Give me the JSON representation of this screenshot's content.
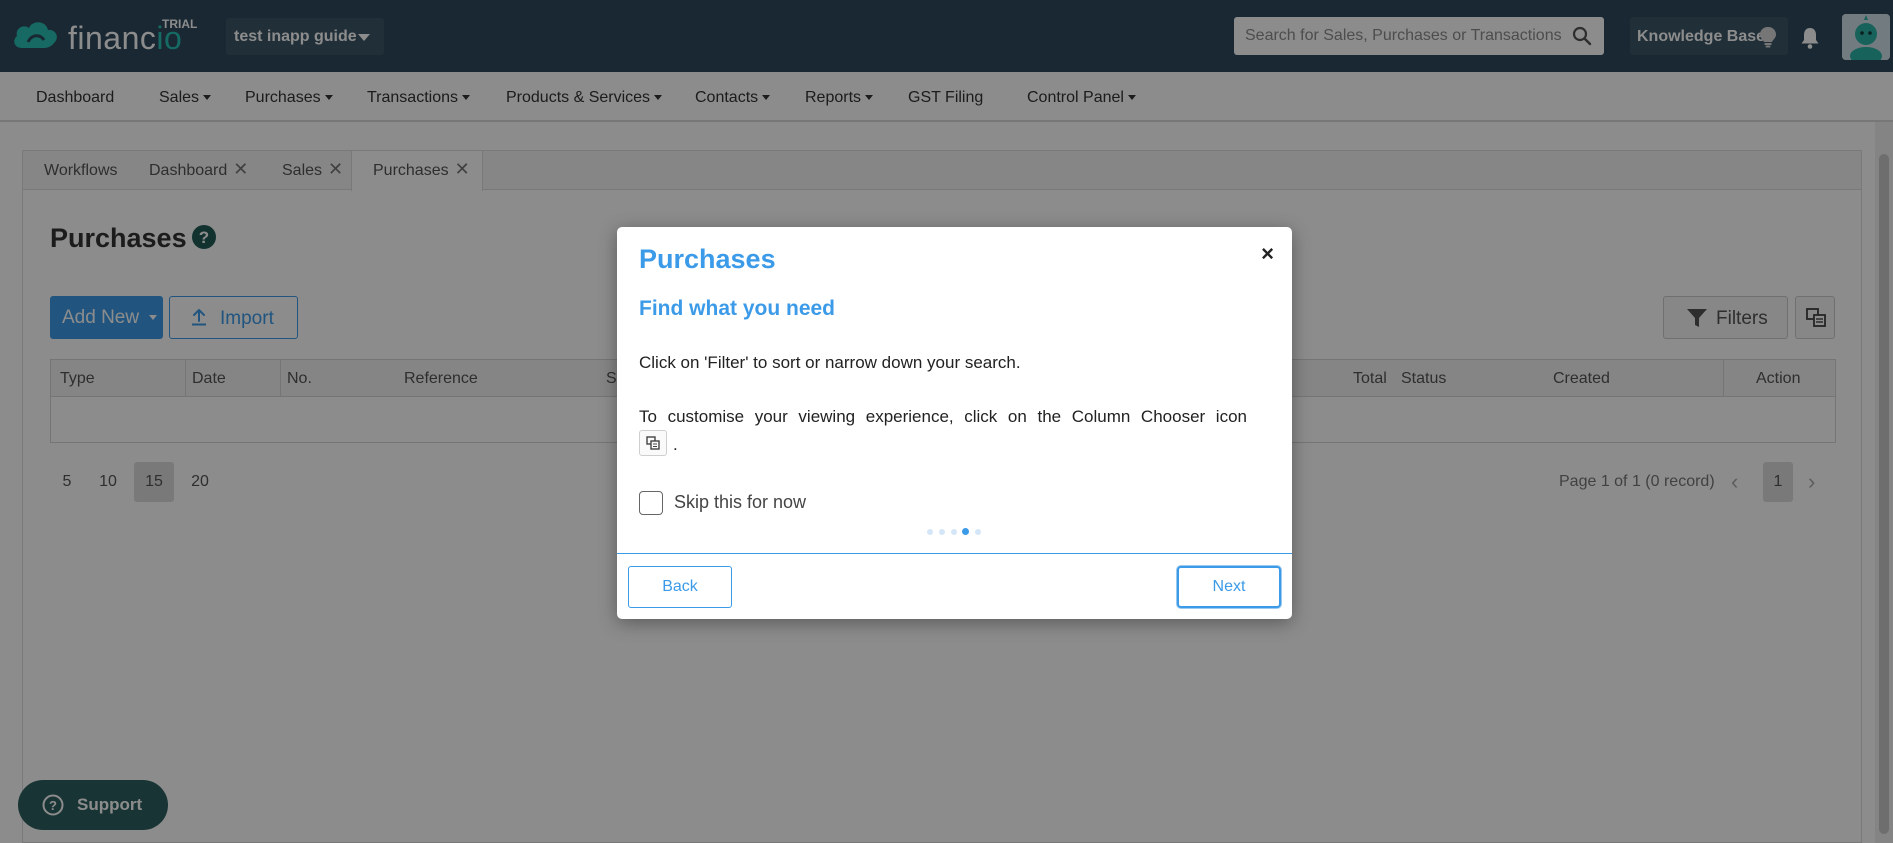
{
  "header": {
    "logo_text_1": "financ",
    "logo_text_2": "io",
    "trial_badge": "TRIAL",
    "org_name": "test inapp guide",
    "search_placeholder": "Search for Sales, Purchases or Transactions",
    "knowledge_base": "Knowledge Base"
  },
  "nav": {
    "items": [
      {
        "label": "Dashboard"
      },
      {
        "label": "Sales"
      },
      {
        "label": "Purchases"
      },
      {
        "label": "Transactions"
      },
      {
        "label": "Products & Services"
      },
      {
        "label": "Contacts"
      },
      {
        "label": "Reports"
      },
      {
        "label": "GST Filing"
      },
      {
        "label": "Control Panel"
      }
    ]
  },
  "tabs": [
    {
      "label": "Workflows"
    },
    {
      "label": "Dashboard"
    },
    {
      "label": "Sales"
    },
    {
      "label": "Purchases"
    }
  ],
  "page": {
    "title": "Purchases",
    "add_new": "Add New",
    "import": "Import",
    "filters": "Filters"
  },
  "table": {
    "columns": [
      "Type",
      "Date",
      "No.",
      "Reference",
      "S",
      "Total",
      "Status",
      "Created",
      "Action"
    ]
  },
  "pagination": {
    "sizes": [
      "5",
      "10",
      "15",
      "20"
    ],
    "selected_size": "15",
    "info": "Page 1 of 1 (0 record)",
    "current_page": "1",
    "prev": "‹",
    "next": "›"
  },
  "support": {
    "label": "Support"
  },
  "modal": {
    "title": "Purchases",
    "close": "×",
    "subtitle": "Find what you need",
    "para1": "Click on 'Filter' to sort or narrow down your search.",
    "para2": "To customise your viewing experience, click on the Column Chooser icon",
    "icon_trailing": ".",
    "skip_label": "Skip this for now",
    "skip_checked": false,
    "step_current": 4,
    "step_total": 5,
    "back": "Back",
    "next": "Next"
  }
}
